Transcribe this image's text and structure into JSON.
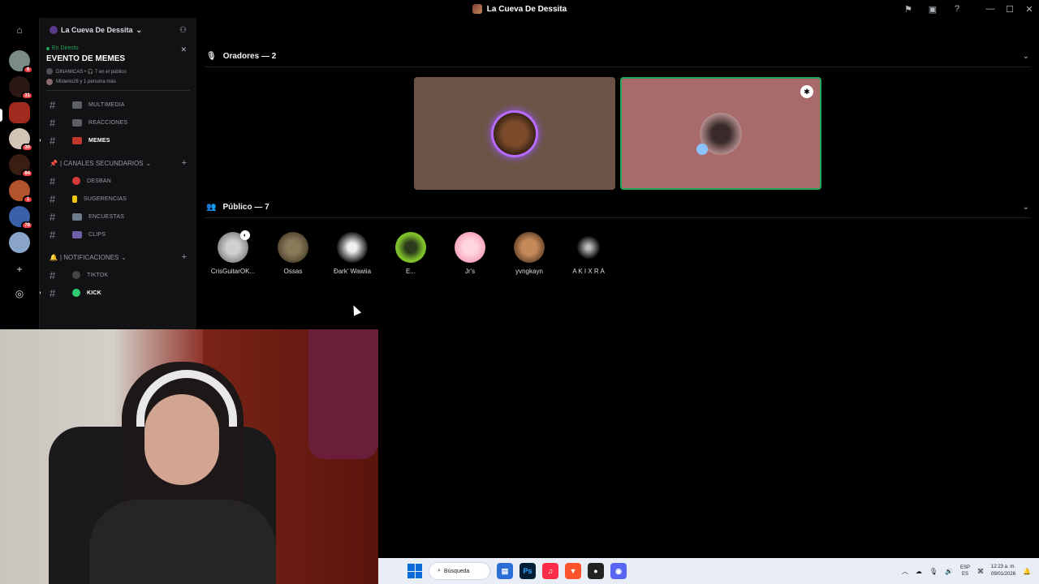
{
  "window": {
    "title": "La Cueva De Dessita"
  },
  "server": {
    "name": "La Cueva De Dessita"
  },
  "rail": {
    "badges": [
      "6",
      "31",
      "30",
      "84",
      "1",
      "78"
    ]
  },
  "event": {
    "live_label": "En Directo",
    "title": "EVENTO DE MEMES",
    "meta_line1": "DINAMICAS • 🎧 7 en el público",
    "meta_line2": "Misterio28 y 1 persona más"
  },
  "channels_top": [
    {
      "label": "MULTIMEDIA"
    },
    {
      "label": "REACCIONES"
    },
    {
      "label": "MEMES"
    }
  ],
  "cat_secondary": {
    "label": "| CANALES SECUNDARIOS"
  },
  "channels_secondary": [
    {
      "label": "DESBAN"
    },
    {
      "label": "SUGERENCIAS"
    },
    {
      "label": "ENCUESTAS"
    },
    {
      "label": "CLIPS"
    }
  ],
  "cat_notif": {
    "label": "| NOTIFICACIONES"
  },
  "channels_notif": [
    {
      "label": "TIKTOK"
    },
    {
      "label": "KICK"
    }
  ],
  "stage": {
    "speakers_header": "Oradores — 2",
    "audience_header": "Público — 7",
    "speaker_tile_colors": [
      "#6b5446",
      "#a86a6a"
    ],
    "audience": [
      {
        "name": "CrisGuitarOK..."
      },
      {
        "name": "Ossas"
      },
      {
        "name": "Ðark’ Wawiia"
      },
      {
        "name": "E..."
      },
      {
        "name": "Jr's"
      },
      {
        "name": "yvngkayn"
      },
      {
        "name": "A K I X R A"
      }
    ]
  },
  "taskbar": {
    "search_placeholder": "Búsqueda",
    "lang_top": "ESP",
    "lang_bottom": "ES",
    "time": "12:23 a. m.",
    "date": "09/01/2026"
  }
}
